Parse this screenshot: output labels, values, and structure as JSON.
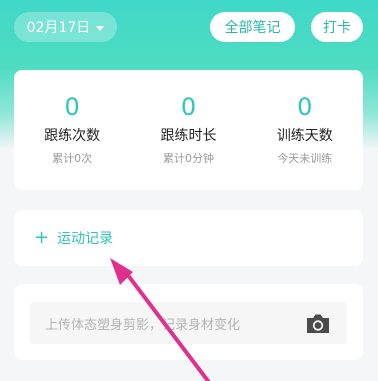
{
  "header": {
    "date": "02月17日",
    "all_notes_label": "全部笔记",
    "checkin_label": "打卡"
  },
  "stats": [
    {
      "value": "0",
      "label": "跟练次数",
      "sub": "累计0次"
    },
    {
      "value": "0",
      "label": "跟练时长",
      "sub": "累计0分钟"
    },
    {
      "value": "0",
      "label": "训练天数",
      "sub": "今天未训练"
    }
  ],
  "record": {
    "plus": "+",
    "label": "运动记录"
  },
  "photo": {
    "placeholder": "上传体态塑身剪影，记录身材变化",
    "icon": "camera-icon"
  },
  "colors": {
    "accent": "#2cc7b6",
    "header_gradient_top": "#3fd8c8",
    "arrow": "#e0308e"
  }
}
